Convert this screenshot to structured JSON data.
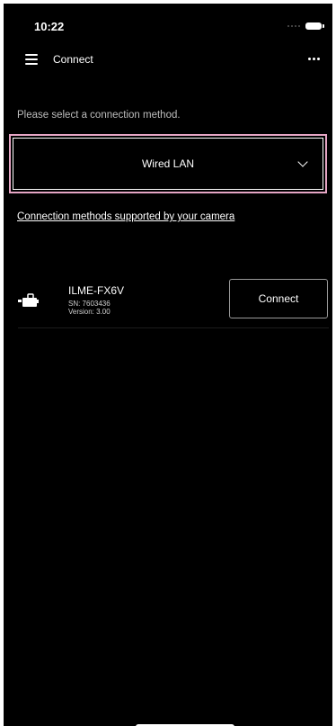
{
  "status_bar": {
    "time": "10:22",
    "signal_icon": "signal-dots-icon",
    "battery_icon": "battery-icon"
  },
  "header": {
    "title": "Connect",
    "menu_icon": "hamburger-menu-icon",
    "more_icon": "more-dots-icon"
  },
  "prompt": "Please select a connection method.",
  "connection_select": {
    "value": "Wired LAN",
    "icon": "chevron-down-icon",
    "highlight_color": "#e5a5c4"
  },
  "methods_link": "Connection methods supported by your camera",
  "devices": [
    {
      "icon": "camera-icon",
      "name": "ILME-FX6V",
      "sn": "SN: 7603436",
      "version": "Version: 3.00",
      "button_label": "Connect"
    }
  ]
}
